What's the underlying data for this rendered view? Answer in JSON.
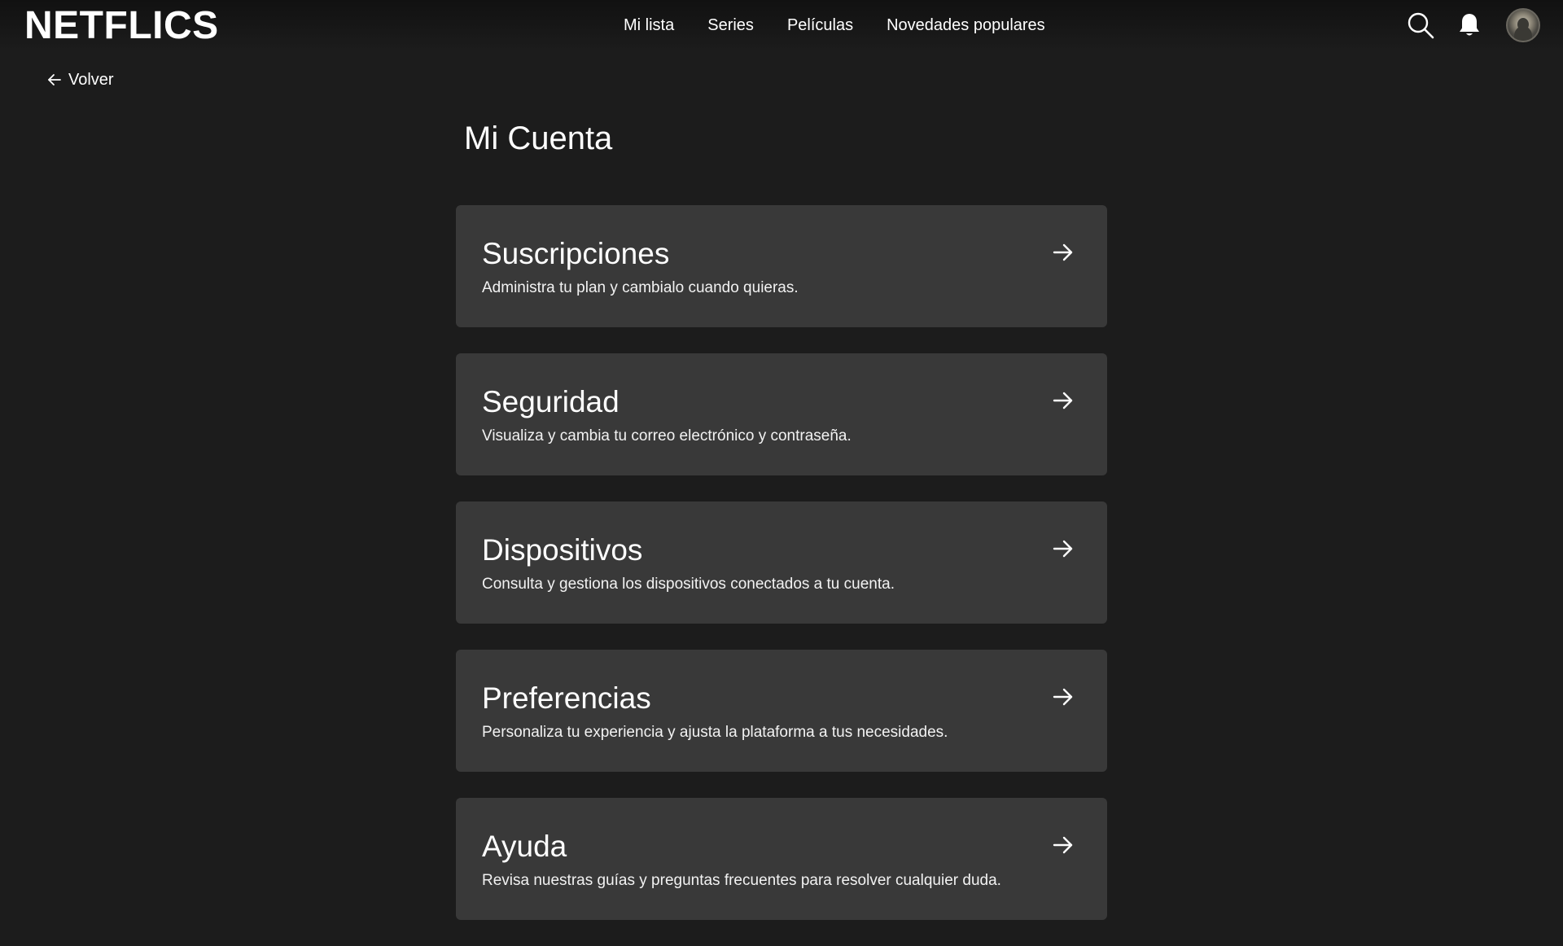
{
  "header": {
    "logo": "NETFLICS",
    "nav": [
      {
        "label": "Mi lista"
      },
      {
        "label": "Series"
      },
      {
        "label": "Películas"
      },
      {
        "label": "Novedades populares"
      }
    ],
    "icons": [
      "search-icon",
      "bell-icon",
      "avatar"
    ]
  },
  "back": {
    "label": "Volver",
    "icon": "arrow-left-icon"
  },
  "page": {
    "title": "Mi Cuenta"
  },
  "cards": [
    {
      "title": "Suscripciones",
      "description": "Administra tu plan y cambialo cuando quieras.",
      "icon": "arrow-right-icon"
    },
    {
      "title": "Seguridad",
      "description": "Visualiza y cambia tu correo electrónico y contraseña.",
      "icon": "arrow-right-icon"
    },
    {
      "title": "Dispositivos",
      "description": "Consulta y gestiona los dispositivos conectados a tu cuenta.",
      "icon": "arrow-right-icon"
    },
    {
      "title": "Preferencias",
      "description": "Personaliza tu experiencia y ajusta la plataforma a tus necesidades.",
      "icon": "arrow-right-icon"
    },
    {
      "title": "Ayuda",
      "description": "Revisa nuestras guías y preguntas frecuentes para resolver cualquier duda.",
      "icon": "arrow-right-icon"
    }
  ],
  "colors": {
    "background": "#1c1c1c",
    "card": "#393939",
    "text": "#ffffff"
  }
}
